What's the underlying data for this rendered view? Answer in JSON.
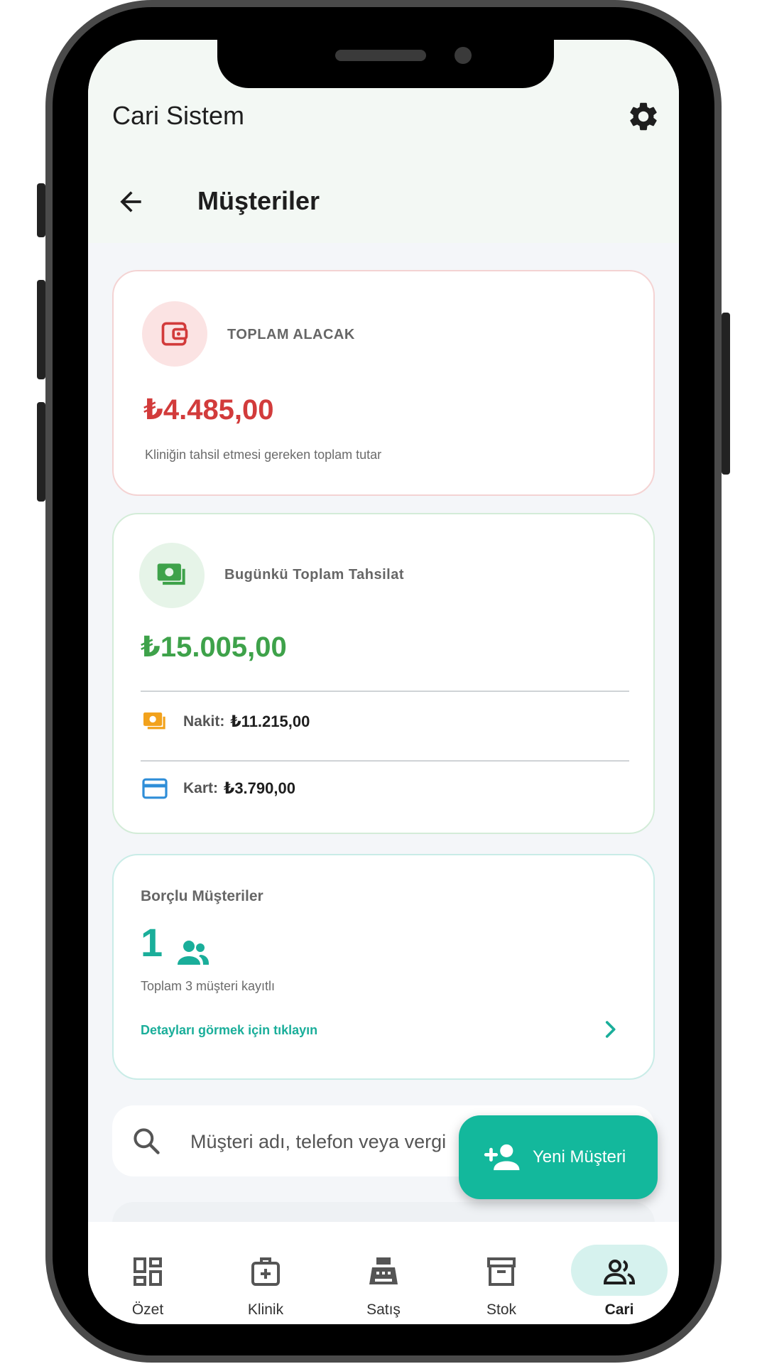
{
  "app": {
    "title": "Cari Sistem"
  },
  "header": {
    "page_title": "Müşteriler"
  },
  "receivable_card": {
    "label": "TOPLAM ALACAK",
    "amount": "₺4.485,00",
    "description": "Kliniğin tahsil etmesi gereken toplam tutar",
    "accent_color": "#d23b3b"
  },
  "collection_card": {
    "label": "Bugünkü Toplam Tahsilat",
    "amount": "₺15.005,00",
    "cash_label": "Nakit:",
    "cash_value": "₺11.215,00",
    "card_label": "Kart:",
    "card_value": "₺3.790,00",
    "accent_color": "#3ea24a"
  },
  "debtors_card": {
    "title": "Borçlu Müşteriler",
    "count": "1",
    "subtitle": "Toplam 3 müşteri kayıtlı",
    "link": "Detayları görmek için tıklayın",
    "accent_color": "#1aae9a"
  },
  "search": {
    "placeholder": "Müşteri adı, telefon veya vergi"
  },
  "fab": {
    "label": "Yeni Müşteri",
    "icon": "person-add-icon"
  },
  "bottom_nav": {
    "items": [
      {
        "label": "Özet",
        "icon": "dashboard-icon"
      },
      {
        "label": "Klinik",
        "icon": "medical-bag-icon"
      },
      {
        "label": "Satış",
        "icon": "cash-register-icon"
      },
      {
        "label": "Stok",
        "icon": "archive-box-icon"
      },
      {
        "label": "Cari",
        "icon": "people-icon",
        "active": true
      }
    ]
  }
}
